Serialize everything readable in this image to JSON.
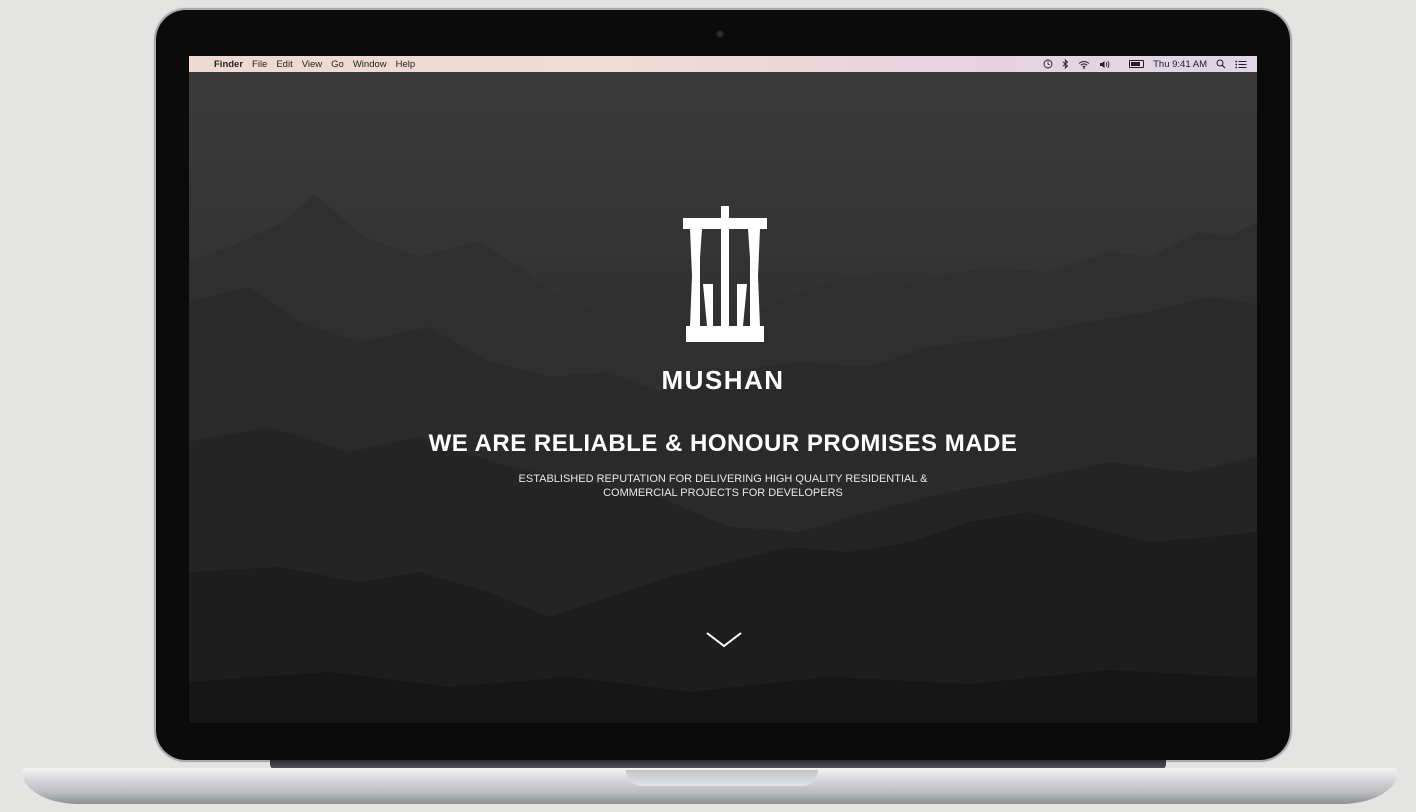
{
  "menubar": {
    "apple_icon": "",
    "app_name": "Finder",
    "items": [
      "File",
      "Edit",
      "View",
      "Go",
      "Window",
      "Help"
    ],
    "status_icons": [
      "time-machine-icon",
      "bluetooth-icon",
      "wifi-icon",
      "volume-icon",
      "battery-icon",
      "spotlight-search-icon",
      "notification-center-icon"
    ],
    "clock": "Thu 9:41 AM"
  },
  "hero": {
    "brand": "MUSHAN",
    "headline": "WE ARE RELIABLE & HONOUR PROMISES MADE",
    "subheadline_line1": "ESTABLISHED REPUTATION FOR DELIVERING HIGH QUALITY RESIDENTIAL &",
    "subheadline_line2": "COMMERCIAL PROJECTS FOR DEVELOPERS",
    "scroll_icon": "chevron-down-icon"
  },
  "colors": {
    "background": "#e4e5e3",
    "bezel": "#0b0b0b",
    "hero_text": "#ffffff"
  }
}
